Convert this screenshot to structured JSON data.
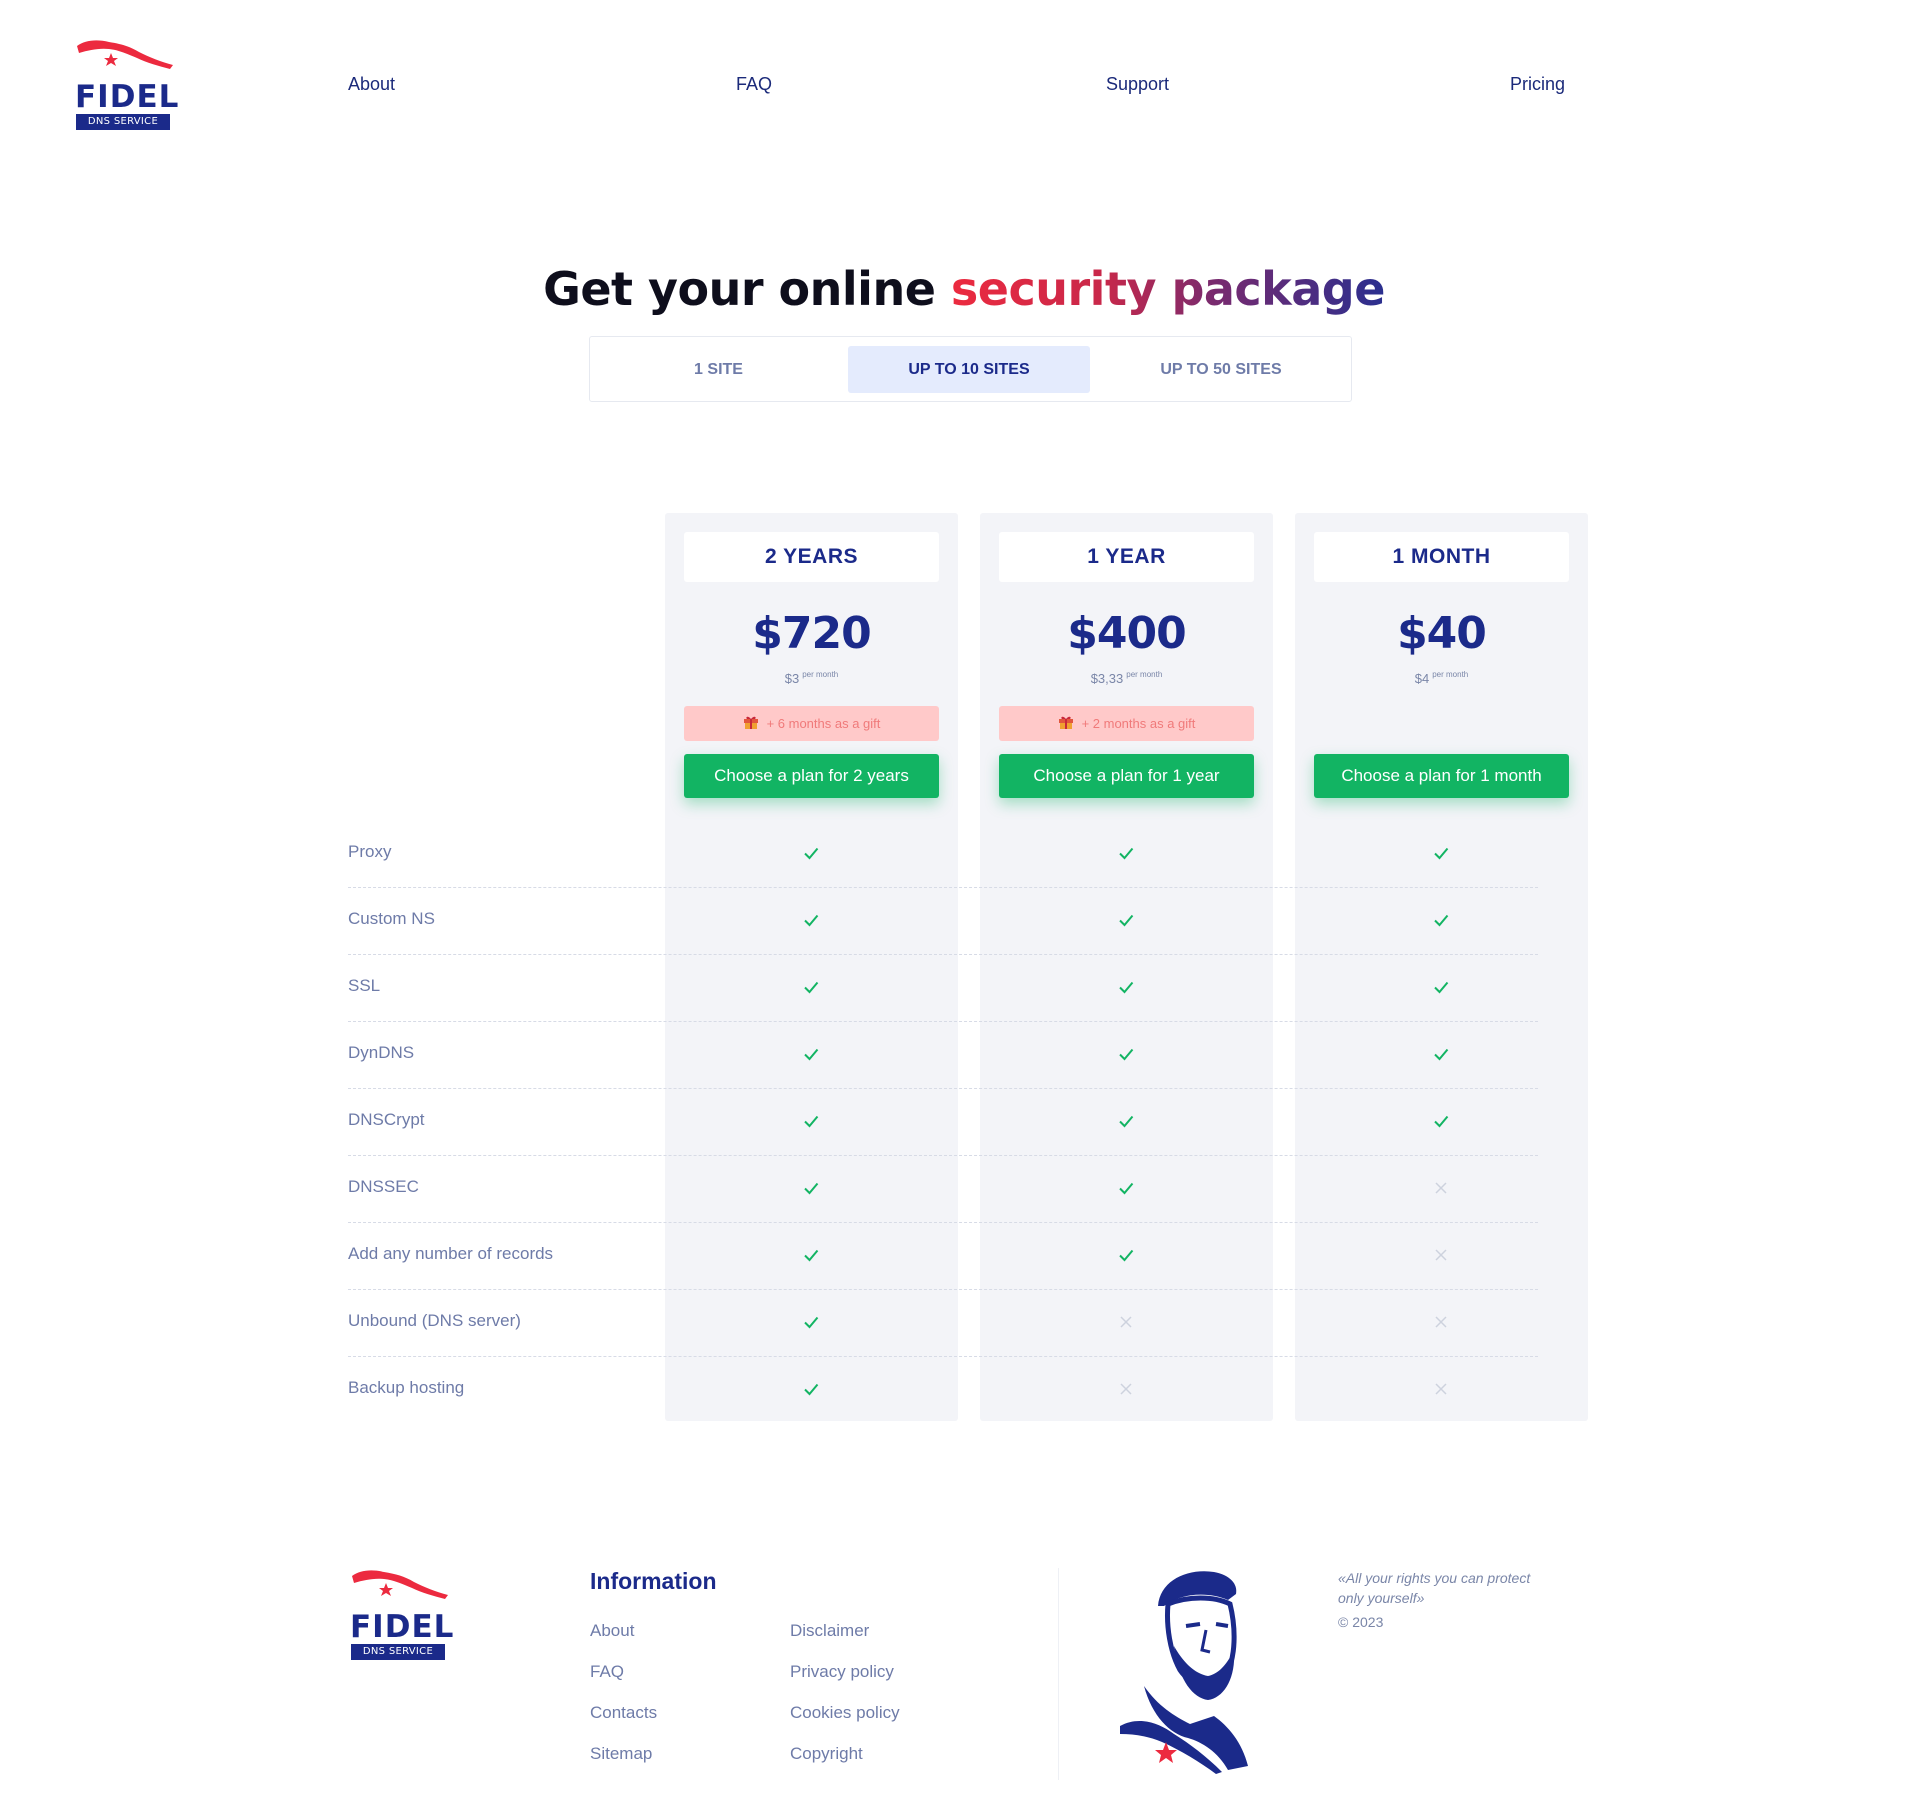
{
  "brand": {
    "name": "FIDEL",
    "tagline": "DNS SERVICE",
    "accent_red": "#ec2a3f",
    "accent_blue": "#1b2a8a",
    "green": "#12b463"
  },
  "nav": [
    {
      "label": "About"
    },
    {
      "label": "FAQ"
    },
    {
      "label": "Support"
    },
    {
      "label": "Pricing"
    }
  ],
  "hero": {
    "title_1": "Get your online ",
    "title_2": "security package"
  },
  "tabs": [
    {
      "label": "1 SITE",
      "active": false
    },
    {
      "label": "UP TO 10 SITES",
      "active": true
    },
    {
      "label": "UP TO 50 SITES",
      "active": false
    }
  ],
  "plans": [
    {
      "period": "2 YEARS",
      "price": "$720",
      "per_month_value": "$3",
      "per_month_unit": "per month",
      "gift": "+ 6 months as a gift",
      "button": "Choose a plan for 2 years"
    },
    {
      "period": "1 YEAR",
      "price": "$400",
      "per_month_value": "$3,33",
      "per_month_unit": "per month",
      "gift": "+ 2 months as a gift",
      "button": "Choose a plan for 1 year"
    },
    {
      "period": "1 MONTH",
      "price": "$40",
      "per_month_value": "$4",
      "per_month_unit": "per month",
      "gift": "",
      "button": "Choose a plan for 1 month"
    }
  ],
  "features": [
    {
      "label": "Proxy",
      "included": [
        true,
        true,
        true
      ]
    },
    {
      "label": "Custom NS",
      "included": [
        true,
        true,
        true
      ]
    },
    {
      "label": "SSL",
      "included": [
        true,
        true,
        true
      ]
    },
    {
      "label": "DynDNS",
      "included": [
        true,
        true,
        true
      ]
    },
    {
      "label": "DNSCrypt",
      "included": [
        true,
        true,
        true
      ]
    },
    {
      "label": "DNSSEC",
      "included": [
        true,
        true,
        false
      ]
    },
    {
      "label": "Add any number of records",
      "included": [
        true,
        true,
        false
      ]
    },
    {
      "label": "Unbound (DNS server)",
      "included": [
        true,
        false,
        false
      ]
    },
    {
      "label": "Backup hosting",
      "included": [
        true,
        false,
        false
      ]
    }
  ],
  "footer": {
    "heading": "Information",
    "links_col1": [
      "About",
      "FAQ",
      "Contacts",
      "Sitemap"
    ],
    "links_col2": [
      "Disclaimer",
      "Privacy policy",
      "Cookies policy",
      "Copyright"
    ],
    "quote": "«All your rights you can protect only yourself»",
    "copyright": "© 2023"
  }
}
